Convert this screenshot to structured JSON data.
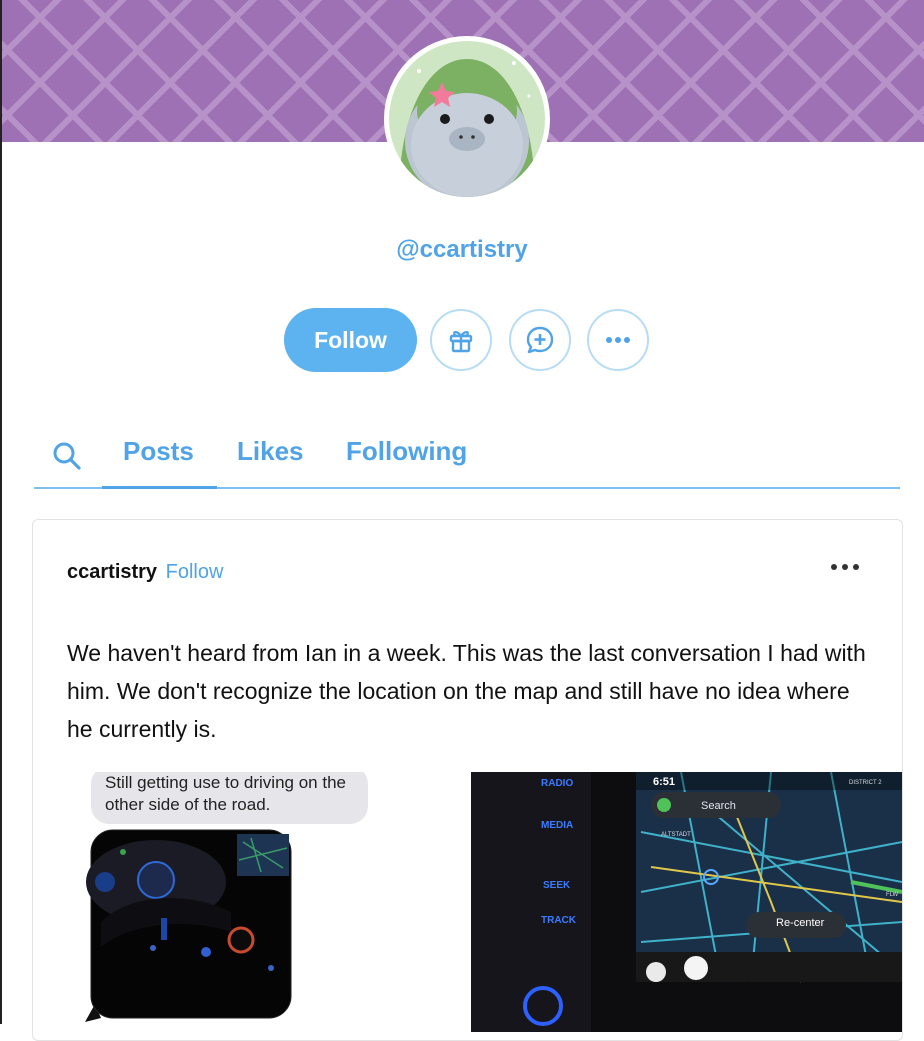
{
  "profile": {
    "username": "@ccartistry"
  },
  "actions": {
    "follow_label": "Follow"
  },
  "tabs": [
    {
      "label": "Posts",
      "active": true
    },
    {
      "label": "Likes",
      "active": false
    },
    {
      "label": "Following",
      "active": false
    }
  ],
  "post": {
    "author": "ccartistry",
    "follow_label": "Follow",
    "text": "We haven't heard from Ian in a week. This was the last conversation I had with him. We don't recognize the location on the map and still have no idea where he currently is.",
    "images": {
      "message_bubble": "Still getting use to driving on the other side of the road.",
      "car_screen": {
        "radio": "RADIO",
        "media": "MEDIA",
        "seek": "SEEK",
        "track": "TRACK",
        "time": "6:51",
        "search": "Search",
        "recenter": "Re-center",
        "district": "DISTRICT 2",
        "altstadt": "ALTSTADT",
        "flw": "FLW"
      }
    }
  },
  "colors": {
    "accent": "#4fa3e6",
    "header_purple": "#9d71b3",
    "button_blue": "#5cb3f0"
  }
}
